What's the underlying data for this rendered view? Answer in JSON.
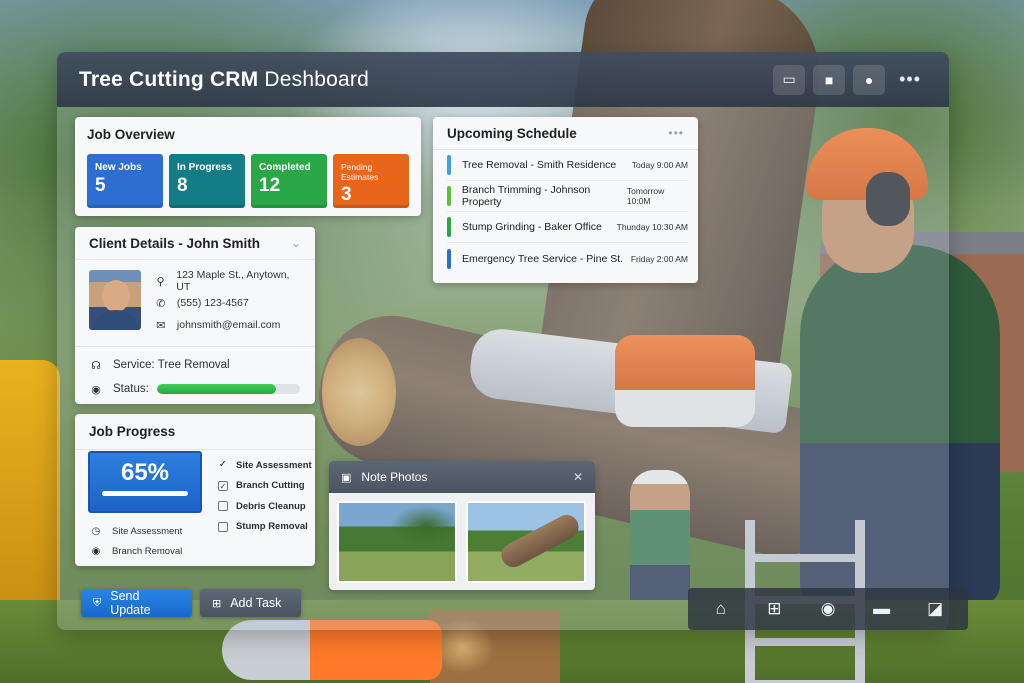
{
  "app": {
    "title_bold": "Tree Cutting CRM",
    "title_light": " Deshboard",
    "actions": [
      {
        "icon": "folder-icon",
        "glyph": "▭"
      },
      {
        "icon": "video-icon",
        "glyph": "■"
      },
      {
        "icon": "user-icon",
        "glyph": "●"
      }
    ],
    "more_glyph": "•••"
  },
  "job_overview": {
    "title": "Job Overview",
    "stats": [
      {
        "label": "New Jobs",
        "value": "5",
        "color": "#2d6fd0"
      },
      {
        "label": "In Progress",
        "value": "8",
        "color": "#137d86"
      },
      {
        "label": "Completed",
        "value": "12",
        "color": "#2aa847"
      },
      {
        "label": "Pending Estimates",
        "value": "3",
        "color": "#e8661c"
      }
    ]
  },
  "client": {
    "title": "Client Details - John Smith",
    "address": "123 Maple St., Anytown, UT",
    "phone": "(555) 123-4567",
    "email": "johnsmith@email.com",
    "service_label": "Service:",
    "service_value": "Tree Removal",
    "status_label": "Status:",
    "status_progress": 0.83
  },
  "job_progress": {
    "title": "Job Progress",
    "percent_text": "65%",
    "checklist": [
      {
        "label": "Site Assessment",
        "state": "checked"
      },
      {
        "label": "Branch Cutting",
        "state": "checked-box"
      },
      {
        "label": "Debris Cleanup",
        "state": "unchecked"
      },
      {
        "label": "Stump Removal",
        "state": "unchecked"
      }
    ],
    "steps": [
      {
        "label": "Site Assessment",
        "icon": "clock-icon"
      },
      {
        "label": "Branch Removal",
        "icon": "radio-icon"
      }
    ]
  },
  "schedule": {
    "title": "Upcoming Schedule",
    "items": [
      {
        "name": "Tree Removal - Smith Residence",
        "when": "Today 9:00 AM",
        "color": "#3aa3e0"
      },
      {
        "name": "Branch Trimming - Johnson Property",
        "when": "Tomorrow 10:0M",
        "color": "#5cbf3c"
      },
      {
        "name": "Stump Grinding - Baker Office",
        "when": "Thunday 10:30 AM",
        "color": "#2aa847"
      },
      {
        "name": "Emergency Tree Service - Pine St.",
        "when": "Friday 2:00 AM",
        "color": "#2d6fd0"
      }
    ]
  },
  "notes": {
    "title": "Note Photos"
  },
  "buttons": {
    "send_update": "Send Update",
    "add_task": "Add Task"
  },
  "taskbar": [
    {
      "icon": "home-icon",
      "glyph": "⌂"
    },
    {
      "icon": "windows-icon",
      "glyph": "⊞"
    },
    {
      "icon": "disc-icon",
      "glyph": "◉"
    },
    {
      "icon": "monitor-icon",
      "glyph": "▬"
    },
    {
      "icon": "tablet-icon",
      "glyph": "◪"
    }
  ]
}
